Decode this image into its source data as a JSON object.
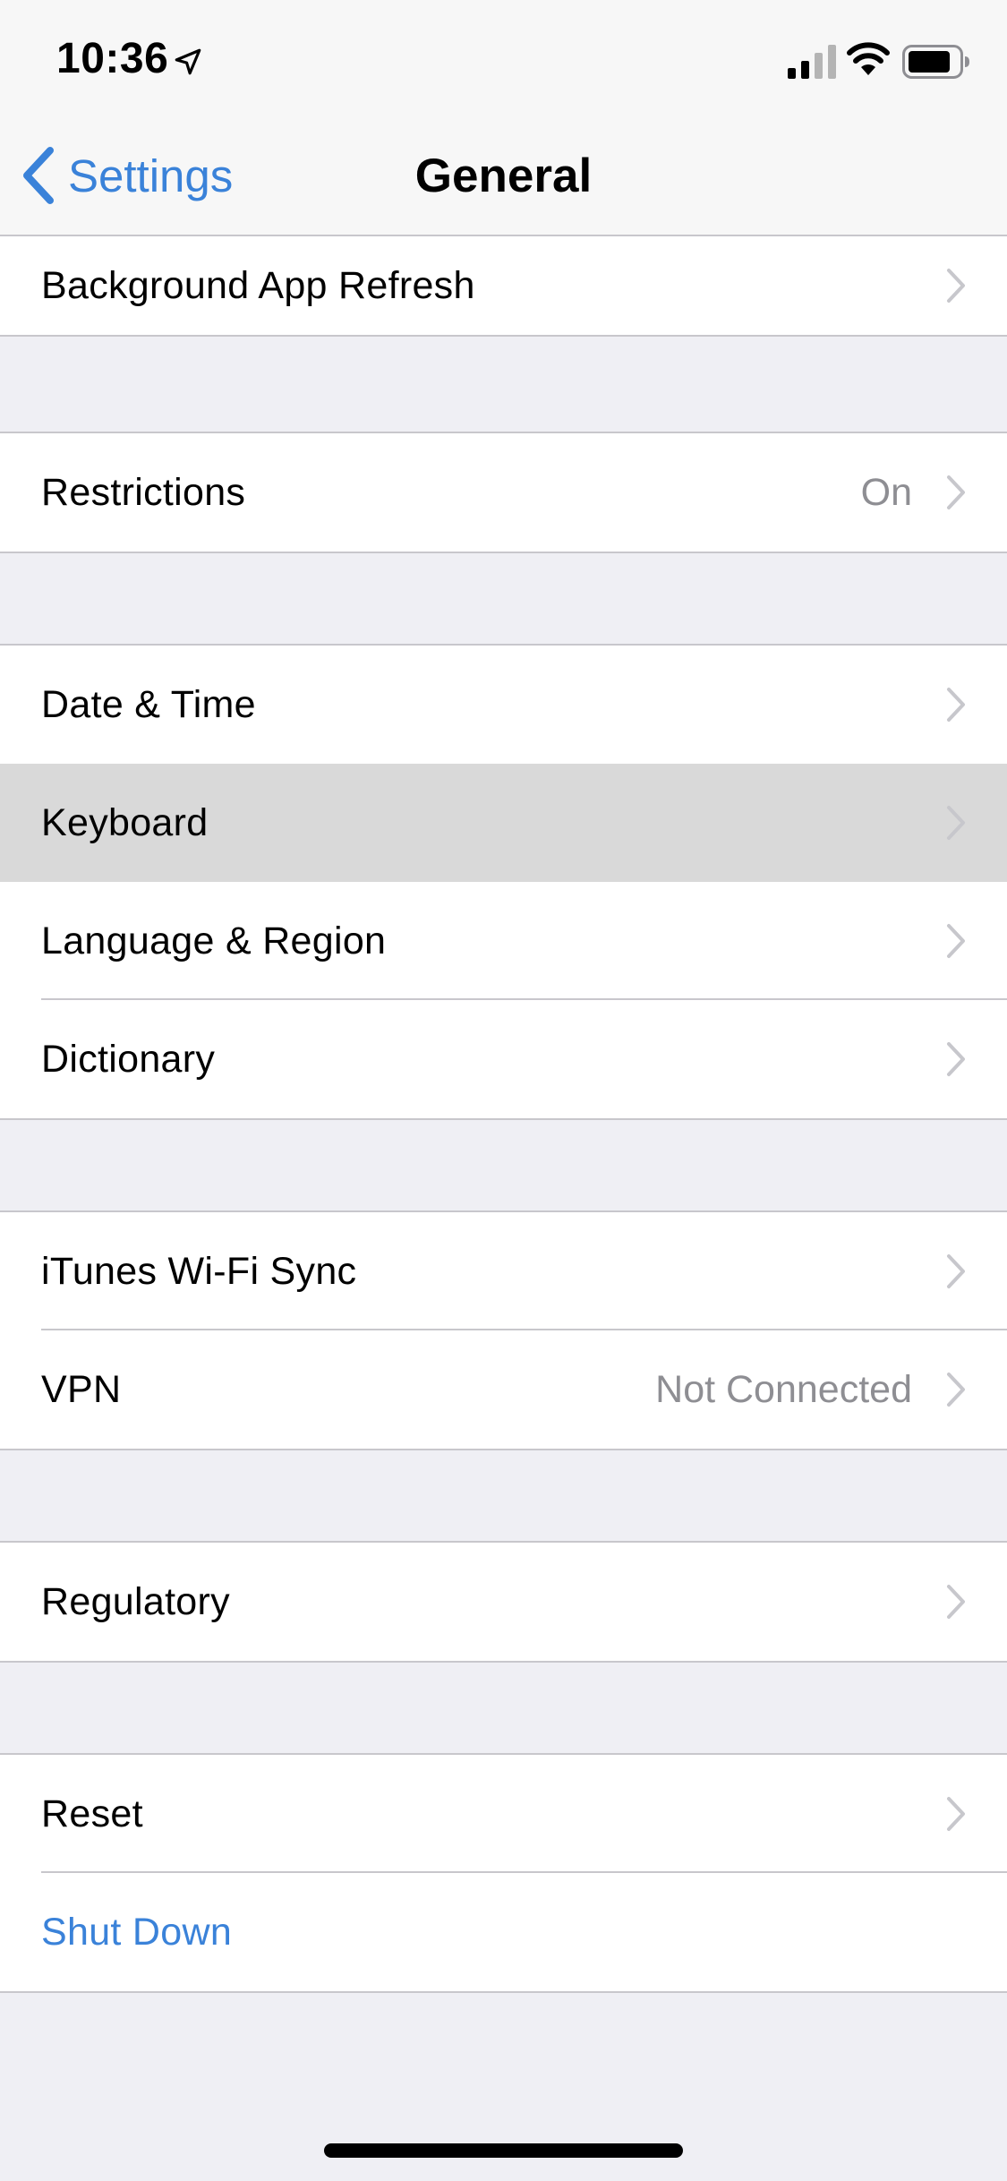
{
  "status_bar": {
    "time": "10:36",
    "location_icon": "location-arrow",
    "cell_icon": "cellular-signal",
    "wifi_icon": "wifi",
    "battery_icon": "battery"
  },
  "nav": {
    "back_label": "Settings",
    "title": "General"
  },
  "colors": {
    "accent": "#3a82d9",
    "background": "#efeff4",
    "selected_row": "#d9d9d9",
    "secondary_text": "#8e8e93"
  },
  "groups": [
    {
      "rows": [
        {
          "label": "Background App Refresh"
        }
      ]
    },
    {
      "rows": [
        {
          "label": "Restrictions",
          "value": "On"
        }
      ]
    },
    {
      "rows": [
        {
          "label": "Date & Time"
        },
        {
          "label": "Keyboard",
          "selected": true
        },
        {
          "label": "Language & Region"
        },
        {
          "label": "Dictionary"
        }
      ]
    },
    {
      "rows": [
        {
          "label": "iTunes Wi-Fi Sync"
        },
        {
          "label": "VPN",
          "value": "Not Connected"
        }
      ]
    },
    {
      "rows": [
        {
          "label": "Regulatory"
        }
      ]
    },
    {
      "rows": [
        {
          "label": "Reset"
        },
        {
          "label": "Shut Down"
        }
      ]
    }
  ]
}
